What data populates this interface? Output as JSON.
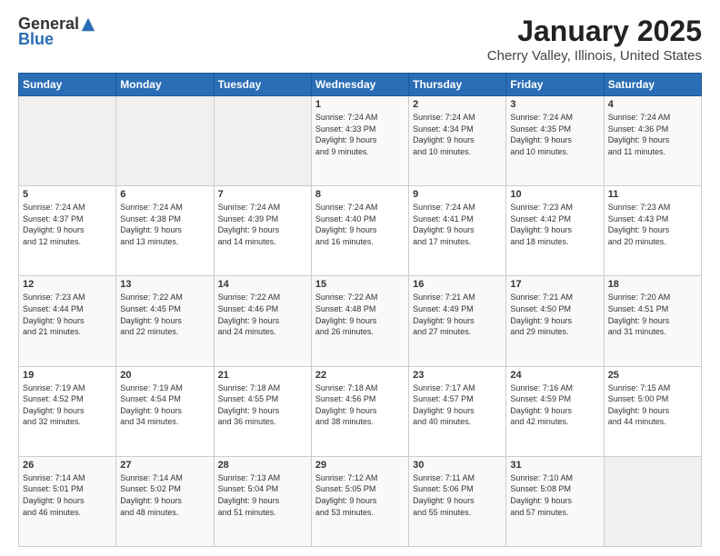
{
  "logo": {
    "general": "General",
    "blue": "Blue"
  },
  "title": "January 2025",
  "subtitle": "Cherry Valley, Illinois, United States",
  "days": [
    "Sunday",
    "Monday",
    "Tuesday",
    "Wednesday",
    "Thursday",
    "Friday",
    "Saturday"
  ],
  "weeks": [
    [
      {
        "day": "",
        "info": ""
      },
      {
        "day": "",
        "info": ""
      },
      {
        "day": "",
        "info": ""
      },
      {
        "day": "1",
        "info": "Sunrise: 7:24 AM\nSunset: 4:33 PM\nDaylight: 9 hours\nand 9 minutes."
      },
      {
        "day": "2",
        "info": "Sunrise: 7:24 AM\nSunset: 4:34 PM\nDaylight: 9 hours\nand 10 minutes."
      },
      {
        "day": "3",
        "info": "Sunrise: 7:24 AM\nSunset: 4:35 PM\nDaylight: 9 hours\nand 10 minutes."
      },
      {
        "day": "4",
        "info": "Sunrise: 7:24 AM\nSunset: 4:36 PM\nDaylight: 9 hours\nand 11 minutes."
      }
    ],
    [
      {
        "day": "5",
        "info": "Sunrise: 7:24 AM\nSunset: 4:37 PM\nDaylight: 9 hours\nand 12 minutes."
      },
      {
        "day": "6",
        "info": "Sunrise: 7:24 AM\nSunset: 4:38 PM\nDaylight: 9 hours\nand 13 minutes."
      },
      {
        "day": "7",
        "info": "Sunrise: 7:24 AM\nSunset: 4:39 PM\nDaylight: 9 hours\nand 14 minutes."
      },
      {
        "day": "8",
        "info": "Sunrise: 7:24 AM\nSunset: 4:40 PM\nDaylight: 9 hours\nand 16 minutes."
      },
      {
        "day": "9",
        "info": "Sunrise: 7:24 AM\nSunset: 4:41 PM\nDaylight: 9 hours\nand 17 minutes."
      },
      {
        "day": "10",
        "info": "Sunrise: 7:23 AM\nSunset: 4:42 PM\nDaylight: 9 hours\nand 18 minutes."
      },
      {
        "day": "11",
        "info": "Sunrise: 7:23 AM\nSunset: 4:43 PM\nDaylight: 9 hours\nand 20 minutes."
      }
    ],
    [
      {
        "day": "12",
        "info": "Sunrise: 7:23 AM\nSunset: 4:44 PM\nDaylight: 9 hours\nand 21 minutes."
      },
      {
        "day": "13",
        "info": "Sunrise: 7:22 AM\nSunset: 4:45 PM\nDaylight: 9 hours\nand 22 minutes."
      },
      {
        "day": "14",
        "info": "Sunrise: 7:22 AM\nSunset: 4:46 PM\nDaylight: 9 hours\nand 24 minutes."
      },
      {
        "day": "15",
        "info": "Sunrise: 7:22 AM\nSunset: 4:48 PM\nDaylight: 9 hours\nand 26 minutes."
      },
      {
        "day": "16",
        "info": "Sunrise: 7:21 AM\nSunset: 4:49 PM\nDaylight: 9 hours\nand 27 minutes."
      },
      {
        "day": "17",
        "info": "Sunrise: 7:21 AM\nSunset: 4:50 PM\nDaylight: 9 hours\nand 29 minutes."
      },
      {
        "day": "18",
        "info": "Sunrise: 7:20 AM\nSunset: 4:51 PM\nDaylight: 9 hours\nand 31 minutes."
      }
    ],
    [
      {
        "day": "19",
        "info": "Sunrise: 7:19 AM\nSunset: 4:52 PM\nDaylight: 9 hours\nand 32 minutes."
      },
      {
        "day": "20",
        "info": "Sunrise: 7:19 AM\nSunset: 4:54 PM\nDaylight: 9 hours\nand 34 minutes."
      },
      {
        "day": "21",
        "info": "Sunrise: 7:18 AM\nSunset: 4:55 PM\nDaylight: 9 hours\nand 36 minutes."
      },
      {
        "day": "22",
        "info": "Sunrise: 7:18 AM\nSunset: 4:56 PM\nDaylight: 9 hours\nand 38 minutes."
      },
      {
        "day": "23",
        "info": "Sunrise: 7:17 AM\nSunset: 4:57 PM\nDaylight: 9 hours\nand 40 minutes."
      },
      {
        "day": "24",
        "info": "Sunrise: 7:16 AM\nSunset: 4:59 PM\nDaylight: 9 hours\nand 42 minutes."
      },
      {
        "day": "25",
        "info": "Sunrise: 7:15 AM\nSunset: 5:00 PM\nDaylight: 9 hours\nand 44 minutes."
      }
    ],
    [
      {
        "day": "26",
        "info": "Sunrise: 7:14 AM\nSunset: 5:01 PM\nDaylight: 9 hours\nand 46 minutes."
      },
      {
        "day": "27",
        "info": "Sunrise: 7:14 AM\nSunset: 5:02 PM\nDaylight: 9 hours\nand 48 minutes."
      },
      {
        "day": "28",
        "info": "Sunrise: 7:13 AM\nSunset: 5:04 PM\nDaylight: 9 hours\nand 51 minutes."
      },
      {
        "day": "29",
        "info": "Sunrise: 7:12 AM\nSunset: 5:05 PM\nDaylight: 9 hours\nand 53 minutes."
      },
      {
        "day": "30",
        "info": "Sunrise: 7:11 AM\nSunset: 5:06 PM\nDaylight: 9 hours\nand 55 minutes."
      },
      {
        "day": "31",
        "info": "Sunrise: 7:10 AM\nSunset: 5:08 PM\nDaylight: 9 hours\nand 57 minutes."
      },
      {
        "day": "",
        "info": ""
      }
    ]
  ]
}
